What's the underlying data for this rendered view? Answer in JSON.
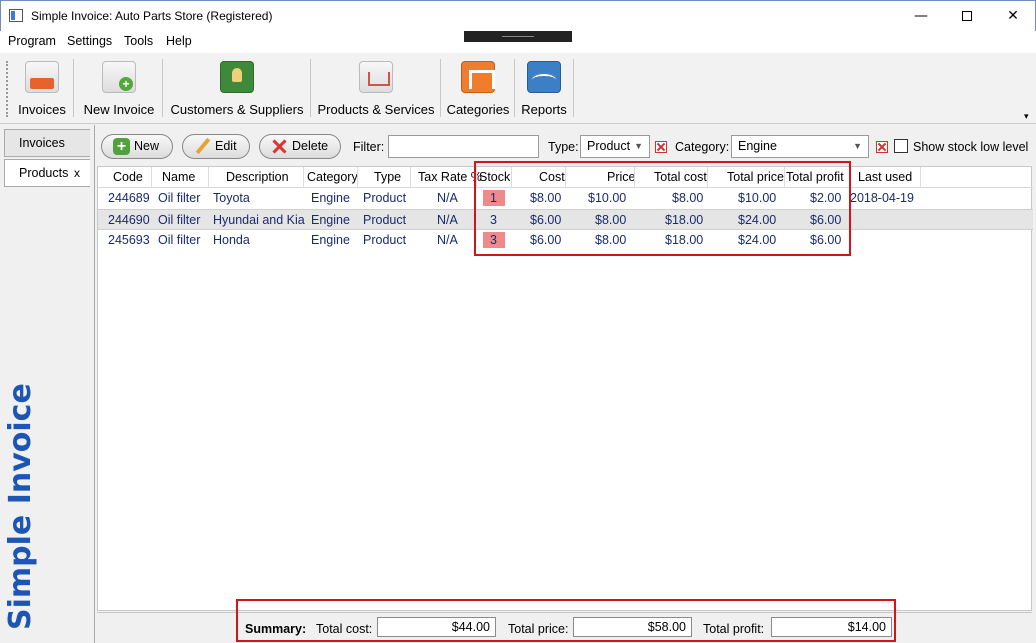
{
  "window": {
    "title": "Simple Invoice: Auto Parts Store (Registered)"
  },
  "menu": [
    "Program",
    "Settings",
    "Tools",
    "Help"
  ],
  "toolbar": {
    "invoices": "Invoices",
    "new_invoice": "New Invoice",
    "customers": "Customers & Suppliers",
    "products": "Products & Services",
    "categories": "Categories",
    "reports": "Reports"
  },
  "side_tabs": {
    "invoices": "Invoices",
    "products": "Products",
    "close": "x"
  },
  "brand": "Simple Invoice",
  "actions": {
    "new": "New",
    "edit": "Edit",
    "delete": "Delete"
  },
  "filter": {
    "filter_label": "Filter:",
    "filter_value": "",
    "type_label": "Type:",
    "type_value": "Product",
    "category_label": "Category:",
    "category_value": "Engine",
    "stock_low_label": "Show stock low level"
  },
  "table": {
    "columns": [
      "Code",
      "Name",
      "Description",
      "Category",
      "Type",
      "Tax Rate %",
      "Stock",
      "Cost",
      "Price",
      "Total cost",
      "Total price",
      "Total profit",
      "Last used"
    ],
    "rows": [
      [
        "244689",
        "Oil filter",
        "Toyota",
        "Engine",
        "Product",
        "N/A",
        "1",
        "$8.00",
        "$10.00",
        "$8.00",
        "$10.00",
        "$2.00",
        "2018-04-19"
      ],
      [
        "244690",
        "Oil filter",
        "Hyundai and Kia",
        "Engine",
        "Product",
        "N/A",
        "3",
        "$6.00",
        "$8.00",
        "$18.00",
        "$24.00",
        "$6.00",
        ""
      ],
      [
        "245693",
        "Oil filter",
        "Honda",
        "Engine",
        "Product",
        "N/A",
        "3",
        "$6.00",
        "$8.00",
        "$18.00",
        "$24.00",
        "$6.00",
        ""
      ]
    ],
    "stock_low_rows": [
      0,
      2
    ]
  },
  "summary": {
    "label": "Summary:",
    "total_cost_label": "Total cost:",
    "total_cost": "$44.00",
    "total_price_label": "Total price:",
    "total_price": "$58.00",
    "total_profit_label": "Total profit:",
    "total_profit": "$14.00"
  },
  "colors": {
    "brand": "#1d55b5",
    "highlight": "#d0161a",
    "stock_low": "#ef8a8a",
    "row_text": "#1a2a6e"
  }
}
